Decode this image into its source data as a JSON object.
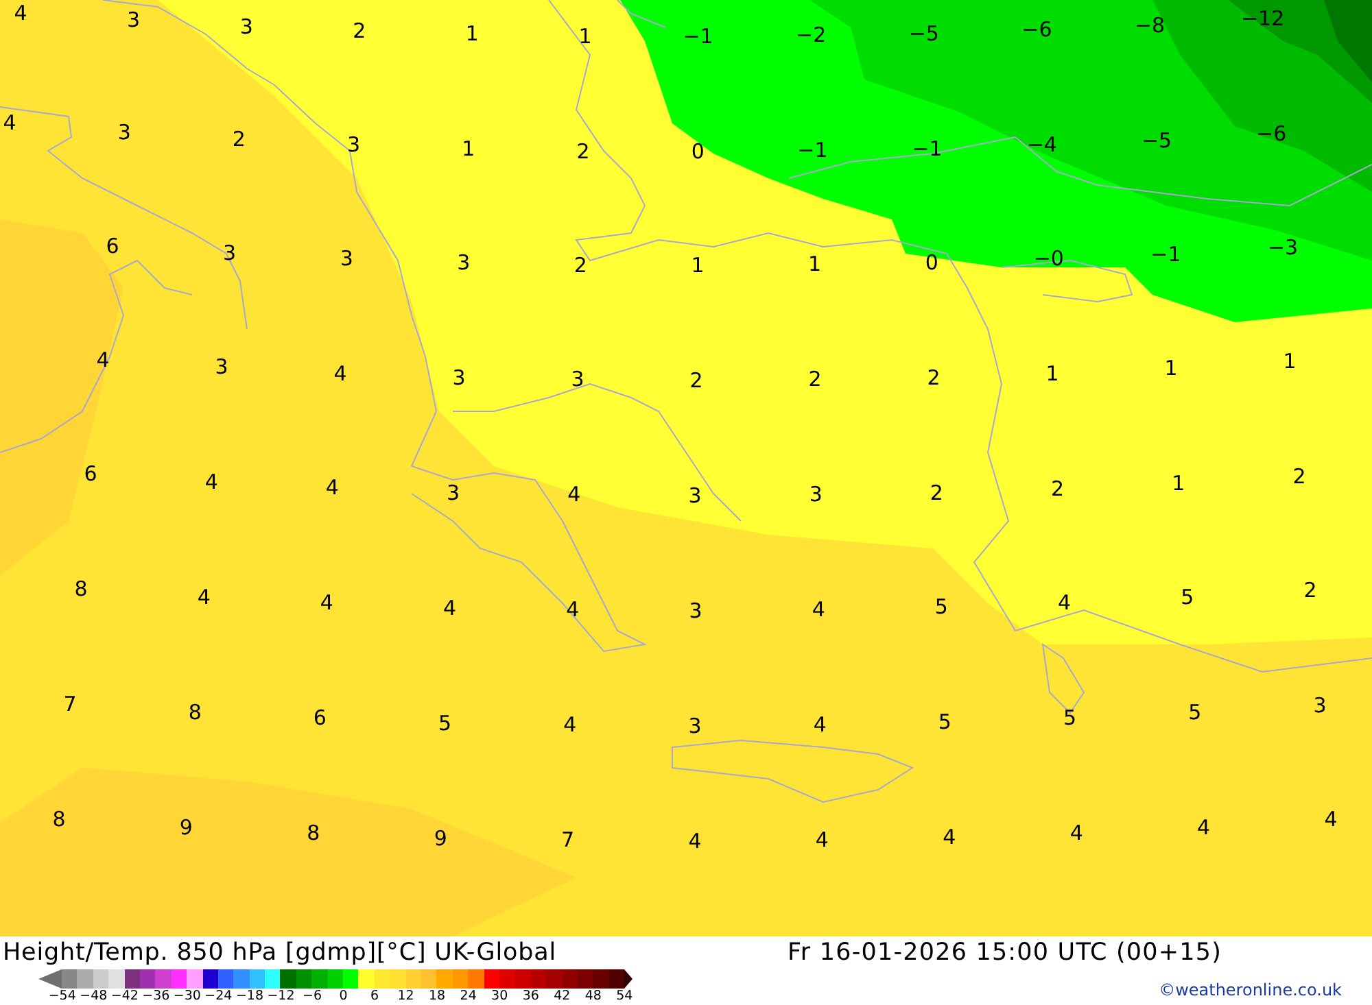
{
  "map": {
    "value_rows": [
      [
        "4",
        "3",
        "3",
        "2",
        "1",
        "1",
        "−1",
        "−2",
        "−5",
        "−6",
        "−8",
        "−12"
      ],
      [
        "4",
        "3",
        "2",
        "3",
        "1",
        "2",
        "0",
        "−1",
        "−1",
        "−4",
        "−5",
        "−6"
      ],
      [
        "6",
        "3",
        "3",
        "3",
        "2",
        "1",
        "1",
        "0",
        "−0",
        "−1",
        "−3"
      ],
      [
        "4",
        "3",
        "4",
        "3",
        "3",
        "2",
        "2",
        "2",
        "1",
        "1",
        "1"
      ],
      [
        "6",
        "4",
        "4",
        "3",
        "4",
        "3",
        "3",
        "2",
        "2",
        "1",
        "2"
      ],
      [
        "8",
        "4",
        "4",
        "4",
        "4",
        "3",
        "4",
        "5",
        "4",
        "5",
        "2"
      ],
      [
        "7",
        "8",
        "6",
        "5",
        "4",
        "3",
        "4",
        "5",
        "5",
        "5",
        "3"
      ],
      [
        "8",
        "9",
        "8",
        "9",
        "7",
        "4",
        "4",
        "4",
        "4",
        "4",
        "4"
      ]
    ]
  },
  "footer": {
    "title": "Height/Temp. 850 hPa [gdmp][°C] UK-Global",
    "valid_time": "Fr 16-01-2026 15:00 UTC (00+15)",
    "credit": "©weatheronline.co.uk"
  },
  "legend": {
    "swatches": [
      {
        "color": "#888888"
      },
      {
        "color": "#aaaaaa"
      },
      {
        "color": "#cccccc"
      },
      {
        "color": "#e0e0e0"
      },
      {
        "color": "#7b3080"
      },
      {
        "color": "#a030b0"
      },
      {
        "color": "#d040d0"
      },
      {
        "color": "#ff30ff"
      },
      {
        "color": "#ffa0ff"
      },
      {
        "color": "#2000d0"
      },
      {
        "color": "#3060ff"
      },
      {
        "color": "#3090ff"
      },
      {
        "color": "#30c0ff"
      },
      {
        "color": "#30ffff"
      },
      {
        "color": "#007000"
      },
      {
        "color": "#009000"
      },
      {
        "color": "#00b000"
      },
      {
        "color": "#00d000"
      },
      {
        "color": "#00ff00"
      },
      {
        "color": "#ffff30"
      },
      {
        "color": "#ffe830"
      },
      {
        "color": "#ffe030"
      },
      {
        "color": "#ffd030"
      },
      {
        "color": "#ffc030"
      },
      {
        "color": "#ffa800"
      },
      {
        "color": "#ff9800"
      },
      {
        "color": "#ff7800"
      },
      {
        "color": "#ff0000"
      },
      {
        "color": "#e00000"
      },
      {
        "color": "#cc0000"
      },
      {
        "color": "#b80000"
      },
      {
        "color": "#a40000"
      },
      {
        "color": "#900000"
      },
      {
        "color": "#7c0000"
      },
      {
        "color": "#680000"
      },
      {
        "color": "#500000"
      }
    ],
    "ticks": [
      "−54",
      "−48",
      "−42",
      "−36",
      "−30",
      "−24",
      "−18",
      "−12",
      "−6",
      "0",
      "6",
      "12",
      "18",
      "24",
      "30",
      "36",
      "42",
      "48",
      "54"
    ]
  }
}
